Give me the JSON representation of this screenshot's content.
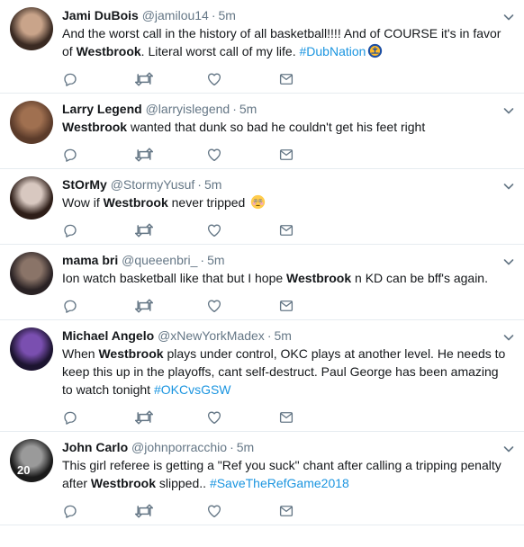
{
  "tweets": [
    {
      "name": "Jami DuBois",
      "handle": "@jamilou14",
      "separator": "·",
      "time": "5m",
      "parts": [
        {
          "text": "And the worst call in the history of all basketball!!!! And of COURSE it's in favor of "
        },
        {
          "text": "Westbrook",
          "bold": true
        },
        {
          "text": ". Literal worst call of my life. "
        },
        {
          "text": "#DubNation",
          "hashtag": true
        }
      ],
      "avatar_colors": [
        "#3a2a22",
        "#c9a48a"
      ],
      "trailing_icon": "warriors-logo-icon"
    },
    {
      "name": "Larry Legend",
      "handle": "@larryislegend",
      "separator": "·",
      "time": "5m",
      "parts": [
        {
          "text": "Westbrook",
          "bold": true
        },
        {
          "text": " wanted that dunk so bad he couldn't get his feet right"
        }
      ],
      "avatar_colors": [
        "#5b3b2a",
        "#a07050"
      ]
    },
    {
      "name": "StOrMy",
      "handle": "@StormyYusuf",
      "separator": "·",
      "time": "5m",
      "parts": [
        {
          "text": "Wow if "
        },
        {
          "text": "Westbrook",
          "bold": true
        },
        {
          "text": " never tripped "
        }
      ],
      "avatar_colors": [
        "#2e1e18",
        "#d8c8c0"
      ],
      "trailing_icon": "flushed-face-emoji-icon"
    },
    {
      "name": "mama bri",
      "handle": "@queeenbri_",
      "separator": "·",
      "time": "5m",
      "parts": [
        {
          "text": "Ion watch basketball like that but I hope "
        },
        {
          "text": "Westbrook",
          "bold": true
        },
        {
          "text": " n KD can be bff's again."
        }
      ],
      "avatar_colors": [
        "#2a2224",
        "#8a7468"
      ]
    },
    {
      "name": "Michael Angelo",
      "handle": "@xNewYorkMadex",
      "separator": "·",
      "time": "5m",
      "parts": [
        {
          "text": "When "
        },
        {
          "text": "Westbrook",
          "bold": true
        },
        {
          "text": " plays under control, OKC plays at another level. He needs to keep this up in the playoffs, cant self-destruct. Paul George has been amazing to watch tonight "
        },
        {
          "text": "#OKCvsGSW",
          "hashtag": true
        }
      ],
      "avatar_colors": [
        "#1c1430",
        "#7a4fb0"
      ]
    },
    {
      "name": "John Carlo",
      "handle": "@johnporracchio",
      "separator": "·",
      "time": "5m",
      "parts": [
        {
          "text": "This girl referee is getting a  \"Ref you suck\" chant after calling a tripping penalty after "
        },
        {
          "text": "Westbrook",
          "bold": true
        },
        {
          "text": " slipped.. "
        },
        {
          "text": "#SaveTheRefGame2018",
          "hashtag": true
        }
      ],
      "avatar_colors": [
        "#1a1a1a",
        "#9a9a9a"
      ],
      "avatar_badge": "20"
    }
  ],
  "action_icons": [
    "reply-icon",
    "retweet-icon",
    "like-icon",
    "direct-message-icon"
  ],
  "colors": {
    "text": "#14171a",
    "muted": "#657786",
    "hashtag": "#1b95e0",
    "divider": "#e6ecf0"
  }
}
